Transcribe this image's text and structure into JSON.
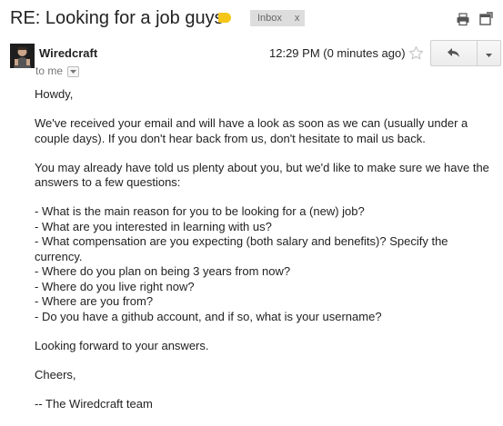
{
  "header": {
    "subject": "RE: Looking for a job guys",
    "label_chip": "Inbox",
    "label_chip_close": "x",
    "label_color": "#f5c518",
    "print_icon": "print-icon",
    "popout_icon": "new-window-icon"
  },
  "message": {
    "sender": "Wiredcraft",
    "recipient_line": "to me",
    "timestamp": "12:29 PM (0 minutes ago)",
    "star_icon": "star-outline-icon",
    "reply_icon": "reply-arrow-icon",
    "more_icon": "caret-down-icon"
  },
  "body": {
    "greeting": "Howdy,",
    "para1": "We've received your email and will have a look as soon as we can (usually under a couple days). If you don't hear back from us, don't hesitate to mail us back.",
    "para2": "You may already have told us plenty about you, but we'd like to make sure we have the answers to a few questions:",
    "questions": [
      "- What is the main reason for you to be looking for a (new) job?",
      "- What are you interested in learning with us?",
      "- What compensation are you expecting (both salary and benefits)? Specify the currency.",
      "- Where do you plan on being 3 years from now?",
      "- Where do you live right now?",
      "- Where are you from?",
      "- Do you have a github account, and if so, what is your username?"
    ],
    "closing_line": "Looking forward to your answers.",
    "signoff": "Cheers,",
    "signature": "-- The Wiredcraft team"
  }
}
